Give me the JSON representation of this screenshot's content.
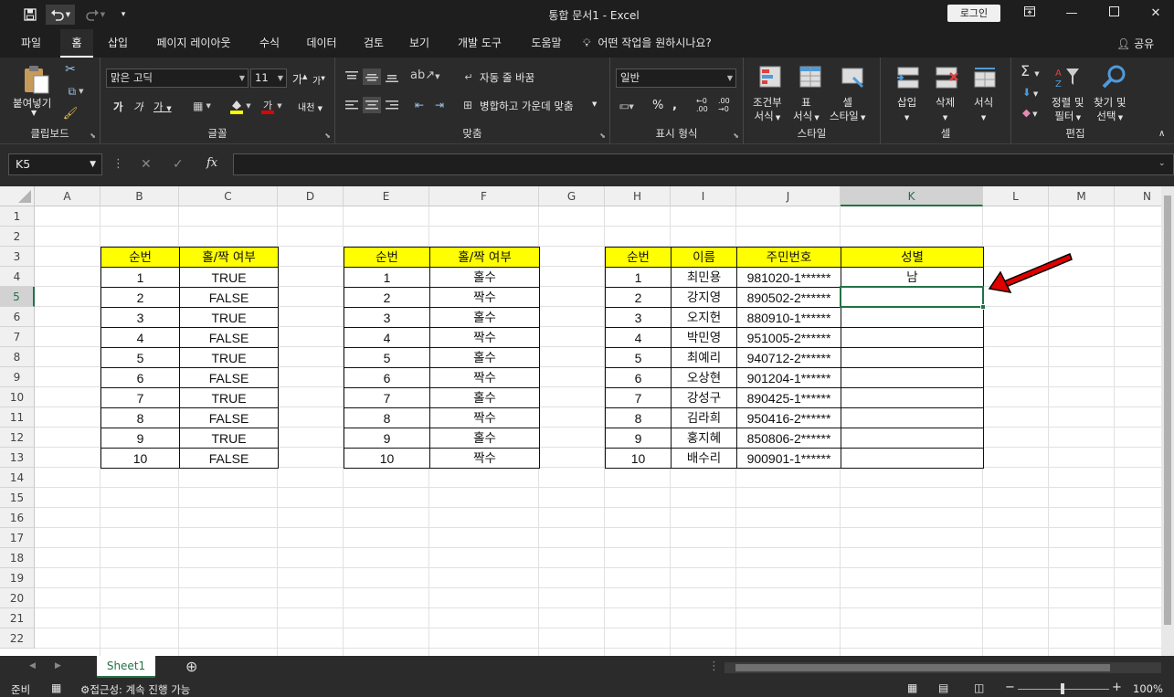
{
  "title_bar": {
    "document_title": "통합 문서1  -  Excel",
    "login_label": "로그인",
    "qat_icons": [
      "save-icon",
      "undo-icon",
      "redo-icon",
      "customize-icon"
    ]
  },
  "ribbon_tabs": [
    {
      "label": "파일",
      "active": false
    },
    {
      "label": "홈",
      "active": true
    },
    {
      "label": "삽입",
      "active": false
    },
    {
      "label": "페이지 레이아웃",
      "active": false
    },
    {
      "label": "수식",
      "active": false
    },
    {
      "label": "데이터",
      "active": false
    },
    {
      "label": "검토",
      "active": false
    },
    {
      "label": "보기",
      "active": false
    },
    {
      "label": "개발 도구",
      "active": false
    },
    {
      "label": "도움말",
      "active": false
    }
  ],
  "tell_me": "어떤 작업을 원하시나요?",
  "share_label": "공유",
  "ribbon": {
    "clipboard": {
      "group": "클립보드",
      "paste": "붙여넣기"
    },
    "font": {
      "group": "글꼴",
      "font_name": "맑은 고딕",
      "font_size": "11"
    },
    "alignment": {
      "group": "맞춤",
      "wrap_text": "자동 줄 바꿈",
      "merge_center": "병합하고 가운데 맞춤"
    },
    "number": {
      "group": "표시 형식",
      "format": "일반"
    },
    "styles": {
      "group": "스타일",
      "cond_1": "조건부",
      "cond_2": "서식",
      "table_1": "표",
      "table_2": "서식",
      "cell_1": "셀",
      "cell_2": "스타일"
    },
    "cells": {
      "group": "셀",
      "insert": "삽입",
      "delete": "삭제",
      "format": "서식"
    },
    "editing": {
      "group": "편집",
      "sort_1": "정렬 및",
      "sort_2": "필터",
      "find_1": "찾기 및",
      "find_2": "선택"
    }
  },
  "formula_bar": {
    "name_box": "K5",
    "formula": ""
  },
  "columns": [
    "A",
    "B",
    "C",
    "D",
    "E",
    "F",
    "G",
    "H",
    "I",
    "J",
    "K",
    "L",
    "M",
    "N"
  ],
  "selected_column": "K",
  "rows": [
    "1",
    "2",
    "3",
    "4",
    "5",
    "6",
    "7",
    "8",
    "9",
    "10",
    "11",
    "12",
    "13",
    "14",
    "15",
    "16",
    "17",
    "18",
    "19",
    "20",
    "21",
    "22"
  ],
  "selected_row": "5",
  "table1": {
    "headers": [
      "순번",
      "홀/짝 여부"
    ],
    "rows": [
      [
        "1",
        "TRUE"
      ],
      [
        "2",
        "FALSE"
      ],
      [
        "3",
        "TRUE"
      ],
      [
        "4",
        "FALSE"
      ],
      [
        "5",
        "TRUE"
      ],
      [
        "6",
        "FALSE"
      ],
      [
        "7",
        "TRUE"
      ],
      [
        "8",
        "FALSE"
      ],
      [
        "9",
        "TRUE"
      ],
      [
        "10",
        "FALSE"
      ]
    ]
  },
  "table2": {
    "headers": [
      "순번",
      "홀/짝 여부"
    ],
    "rows": [
      [
        "1",
        "홀수"
      ],
      [
        "2",
        "짝수"
      ],
      [
        "3",
        "홀수"
      ],
      [
        "4",
        "짝수"
      ],
      [
        "5",
        "홀수"
      ],
      [
        "6",
        "짝수"
      ],
      [
        "7",
        "홀수"
      ],
      [
        "8",
        "짝수"
      ],
      [
        "9",
        "홀수"
      ],
      [
        "10",
        "짝수"
      ]
    ]
  },
  "table3": {
    "headers": [
      "순번",
      "이름",
      "주민번호",
      "성별"
    ],
    "rows": [
      [
        "1",
        "최민용",
        "981020-1******",
        "남"
      ],
      [
        "2",
        "강지영",
        "890502-2******",
        ""
      ],
      [
        "3",
        "오지헌",
        "880910-1******",
        ""
      ],
      [
        "4",
        "박민영",
        "951005-2******",
        ""
      ],
      [
        "5",
        "최예리",
        "940712-2******",
        ""
      ],
      [
        "6",
        "오상현",
        "901204-1******",
        ""
      ],
      [
        "7",
        "강성구",
        "890425-1******",
        ""
      ],
      [
        "8",
        "김라희",
        "950416-2******",
        ""
      ],
      [
        "9",
        "홍지혜",
        "850806-2******",
        ""
      ],
      [
        "10",
        "배수리",
        "900901-1******",
        ""
      ]
    ]
  },
  "sheet_tab": "Sheet1",
  "status": {
    "mode": "준비",
    "accessibility": "접근성: 계속 진행 가능",
    "zoom": "100%"
  },
  "colors": {
    "header_fill": "#ffff00",
    "selection": "#217346",
    "arrow": "#e00000"
  }
}
